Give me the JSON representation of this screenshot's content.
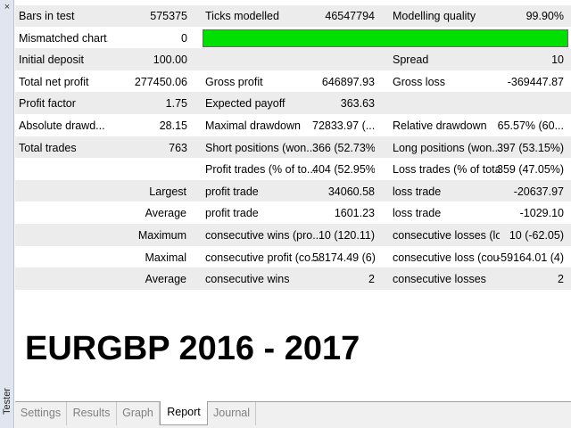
{
  "side": {
    "label": "Tester",
    "close": "×"
  },
  "report": {
    "rows": [
      [
        "Bars in test",
        "575375",
        "Ticks modelled",
        "46547794",
        "Modelling quality",
        "99.90%"
      ],
      [
        "Mismatched chart...",
        "0",
        "",
        "",
        "",
        ""
      ],
      [
        "Initial deposit",
        "100.00",
        "",
        "",
        "Spread",
        "10"
      ],
      [
        "Total net profit",
        "277450.06",
        "Gross profit",
        "646897.93",
        "Gross loss",
        "-369447.87"
      ],
      [
        "Profit factor",
        "1.75",
        "Expected payoff",
        "363.63",
        "",
        ""
      ],
      [
        "Absolute drawd...",
        "28.15",
        "Maximal drawdown",
        "72833.97 (...",
        "Relative drawdown",
        "65.57% (60..."
      ],
      [
        "Total trades",
        "763",
        "Short positions (won...",
        "366 (52.73%)",
        "Long positions (won...",
        "397 (53.15%)"
      ],
      [
        "",
        "",
        "Profit trades (% of to...",
        "404 (52.95%)",
        "Loss trades (% of total)",
        "359 (47.05%)"
      ],
      [
        "Largest",
        "",
        "profit trade",
        "34060.58",
        "loss trade",
        "-20637.97"
      ],
      [
        "Average",
        "",
        "profit trade",
        "1601.23",
        "loss trade",
        "-1029.10"
      ],
      [
        "Maximum",
        "",
        "consecutive wins (pro...",
        "10 (120.11)",
        "consecutive losses (lo...",
        "10 (-62.05)"
      ],
      [
        "Maximal",
        "",
        "consecutive profit (co...",
        "58174.49 (6)",
        "consecutive loss (cou...",
        "-59164.01 (4)"
      ],
      [
        "Average",
        "",
        "consecutive wins",
        "2",
        "consecutive losses",
        "2"
      ]
    ]
  },
  "overlay_title": "EURGBP 2016 - 2017",
  "colors": {
    "quality_bar": "#00e000",
    "row_gray": "#ececec"
  },
  "tabs": {
    "settings": "Settings",
    "results": "Results",
    "graph": "Graph",
    "report": "Report",
    "journal": "Journal"
  }
}
